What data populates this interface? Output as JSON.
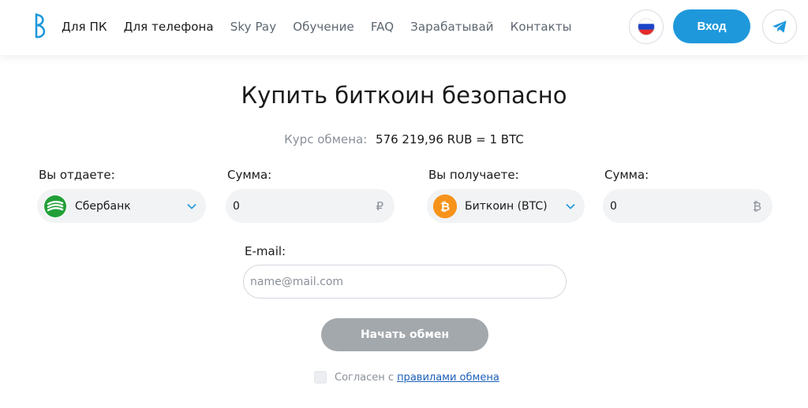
{
  "header": {
    "nav": [
      "Для ПК",
      "Для телефона",
      "Sky Pay",
      "Обучение",
      "FAQ",
      "Зарабатывай",
      "Контакты"
    ],
    "login_label": "Вход",
    "lang_icon": "russia-flag-icon",
    "social_icon": "telegram-icon",
    "accent": "#1e98db"
  },
  "main": {
    "title": "Купить биткоин безопасно",
    "rate_label": "Курс обмена:",
    "rate_value": "576 219,96 RUB = 1 BTC",
    "give": {
      "label": "Вы отдаете:",
      "method": "Сбербанк",
      "method_icon": "sberbank-icon",
      "method_color": "#21a038"
    },
    "give_amount": {
      "label": "Сумма:",
      "value": "0",
      "currency": "₽"
    },
    "get": {
      "label": "Вы получаете:",
      "method": "Биткоин (BTC)",
      "method_icon": "bitcoin-icon",
      "method_color": "#f7931a"
    },
    "get_amount": {
      "label": "Сумма:",
      "value": "0",
      "currency": "₿"
    },
    "email": {
      "label": "E-mail:",
      "placeholder": "name@mail.com",
      "value": ""
    },
    "submit_label": "Начать обмен",
    "agree_text": "Согласен с",
    "agree_link": "правилами обмена"
  }
}
